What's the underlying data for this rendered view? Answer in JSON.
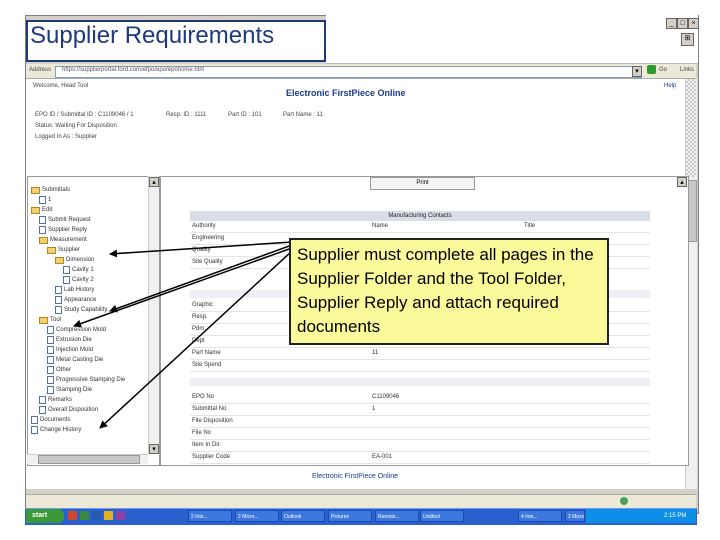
{
  "slide": {
    "title": "Supplier Requirements",
    "callout": "Supplier must complete all pages in the Supplier Folder and the Tool Folder, Supplier Reply and attach required documents"
  },
  "browser": {
    "address_label": "Address",
    "address_value": "https://supplierportal.ford.com/efpo/epo/epohome.htm",
    "go_label": "Go",
    "links_label": "Links"
  },
  "app": {
    "welcome": "Welcome, Head Tool",
    "help": "Help",
    "header_title": "Electronic FirstPiece Online",
    "info_line1_a": "EPO ID / Submittal ID : C1109046 / 1",
    "info_line1_b": "Resp. ID : 1111",
    "info_line1_c": "Part ID : 101",
    "info_line1_d": "Part Name : 11",
    "info_line2": "Status: Waiting For Disposition",
    "info_line3": "Logged In As : Supplier",
    "print_button": "Print",
    "footer_title": "Electronic FirstPiece Online"
  },
  "tree": {
    "items": [
      {
        "label": "Submittals",
        "kind": "folder",
        "indent": 0
      },
      {
        "label": "1",
        "kind": "doc",
        "indent": 1
      },
      {
        "label": "Edit",
        "kind": "folder",
        "indent": 0
      },
      {
        "label": "Submit Request",
        "kind": "doc",
        "indent": 1
      },
      {
        "label": "Supplier Reply",
        "kind": "doc",
        "indent": 1
      },
      {
        "label": "Measurement",
        "kind": "folder",
        "indent": 1
      },
      {
        "label": "Supplier",
        "kind": "folder",
        "indent": 2
      },
      {
        "label": "Dimension",
        "kind": "folder",
        "indent": 3
      },
      {
        "label": "Cavity 1",
        "kind": "doc",
        "indent": 4
      },
      {
        "label": "Cavity 2",
        "kind": "doc",
        "indent": 4
      },
      {
        "label": "Lab History",
        "kind": "doc",
        "indent": 3
      },
      {
        "label": "Appearance",
        "kind": "doc",
        "indent": 3
      },
      {
        "label": "Study Capability",
        "kind": "doc",
        "indent": 3
      },
      {
        "label": "Tool",
        "kind": "folder",
        "indent": 1
      },
      {
        "label": "Compression Mold",
        "kind": "doc",
        "indent": 2
      },
      {
        "label": "Extrusion Die",
        "kind": "doc",
        "indent": 2
      },
      {
        "label": "Injection Mold",
        "kind": "doc",
        "indent": 2
      },
      {
        "label": "Metal Casting Die",
        "kind": "doc",
        "indent": 2
      },
      {
        "label": "Other",
        "kind": "doc",
        "indent": 2
      },
      {
        "label": "Progressive Stamping Die",
        "kind": "doc",
        "indent": 2
      },
      {
        "label": "Stamping Die",
        "kind": "doc",
        "indent": 2
      },
      {
        "label": "Remarks",
        "kind": "doc",
        "indent": 1
      },
      {
        "label": "Overall Disposition",
        "kind": "doc",
        "indent": 1
      },
      {
        "label": "Documents",
        "kind": "doc",
        "indent": 0
      },
      {
        "label": "Change History",
        "kind": "doc",
        "indent": 0
      }
    ]
  },
  "main": {
    "section_title": "Manufacturing Contacts",
    "columns": [
      "Authority",
      "Name",
      "Title"
    ],
    "rows_a": [
      {
        "label": "Engineering",
        "value": ""
      },
      {
        "label": "Quality",
        "value": ""
      },
      {
        "label": "Site Quality",
        "value": ""
      }
    ],
    "rows_b": [
      {
        "label": "Graphic",
        "value": ""
      },
      {
        "label": "Resp.",
        "value": ""
      },
      {
        "label": "Pdm",
        "value": ""
      },
      {
        "label": "Dept",
        "value": ""
      },
      {
        "label": "Part Name",
        "value": "11"
      },
      {
        "label": "Site Spend",
        "value": ""
      }
    ],
    "rows_c": [
      {
        "label": "EPO No",
        "value": "C1109046"
      },
      {
        "label": "Submittal No",
        "value": "1"
      },
      {
        "label": "File Disposition",
        "value": ""
      },
      {
        "label": "File No",
        "value": ""
      },
      {
        "label": "Item In Dir.",
        "value": ""
      },
      {
        "label": "Supplier Code",
        "value": "EA-001"
      }
    ]
  },
  "taskbar": {
    "start_label": "start",
    "buttons": [
      "2 Inte...",
      "2 Micro...",
      "Outlook",
      "Pictures",
      "Remote...",
      "Untitled",
      "4 Inte...",
      "2 Micro..."
    ],
    "clock": "2:15 PM"
  }
}
